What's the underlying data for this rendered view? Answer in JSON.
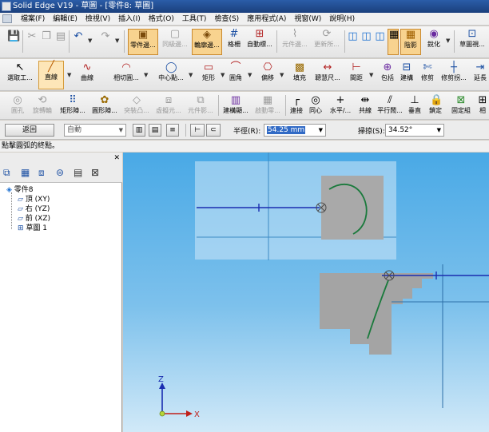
{
  "window": {
    "title": "Solid Edge V19 - 草圖 - [零件8: 草圖]"
  },
  "menu": [
    "檔案(F)",
    "編輯(E)",
    "檢視(V)",
    "插入(I)",
    "格式(O)",
    "工具(T)",
    "檢查(S)",
    "應用程式(A)",
    "視窗(W)",
    "說明(H)"
  ],
  "toolbar1": {
    "parts_lib": "零件邊...",
    "same_level": "同級邊...",
    "contour": "輪廓邊...",
    "grid": "格柵",
    "auto_dim": "自動標...",
    "feature_edge": "元件邊...",
    "update": "更新所...",
    "shade": "陰影",
    "sharpen": "銳化",
    "sketch_view": "草圖視..."
  },
  "toolbar2": {
    "select": "選取工...",
    "line": "直線",
    "curve": "曲線",
    "tangent": "相切圓...",
    "center_point": "中心點...",
    "rectangle": "矩形",
    "fillet": "圓角",
    "offset": "偏移",
    "fill": "填充",
    "smart_dim": "聰慧尺...",
    "spacing": "間距",
    "include": "包括",
    "build": "建構",
    "trim": "修剪",
    "trim_corner": "修剪拐...",
    "extend": "延長"
  },
  "toolbar3": {
    "hole": "圓孔",
    "rotate": "旋轉輪",
    "rect_pattern": "矩形陣...",
    "circ_pattern": "圓形陣...",
    "protrude": "突裝凸...",
    "virtual": "虛擬元...",
    "component": "元件影...",
    "build_anno": "建構顯...",
    "axis": "啟動零...",
    "connect": "連接",
    "concentric": "同心",
    "horizontal": "水平/...",
    "collinear": "共線",
    "parallel": "平行鬧...",
    "perpendicular": "垂直",
    "lock": "鎖定",
    "fixed": "固定組",
    "more": "相"
  },
  "ribbon": {
    "back_button": "返回",
    "mode_value": "自動",
    "radius_label": "半徑(R):",
    "radius_value": "54.25 mm",
    "sweep_label": "掃掠(S):",
    "sweep_value": "34.52°"
  },
  "status": {
    "prompt": "點擊圓弧的終點。"
  },
  "tree": {
    "root": "零件8",
    "items": [
      "頂 (XY)",
      "右 (YZ)",
      "前 (XZ)",
      "草圖 1"
    ]
  },
  "axes": {
    "z": "Z",
    "x": "X"
  },
  "colors": {
    "accent": "#f8d38f",
    "canvas_top": "#49a9e6",
    "arc": "#1a7a3c"
  }
}
